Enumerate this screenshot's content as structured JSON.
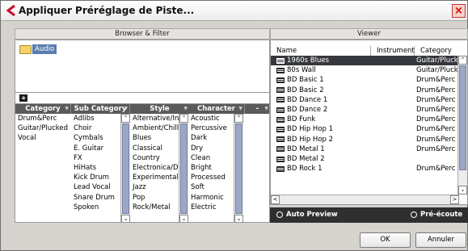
{
  "window": {
    "title": "Appliquer Préréglage de Piste...",
    "close_glyph": "×"
  },
  "browser": {
    "title": "Browser & Filter",
    "folder_label": "Audio",
    "filter_icon_glyph": "a"
  },
  "filter": {
    "columns": [
      {
        "header": "Category",
        "items": [
          "Drum&Perc",
          "Guitar/Plucked",
          "Vocal"
        ]
      },
      {
        "header": "Sub Category",
        "items": [
          "Adlibs",
          "Choir",
          "Cymbals",
          "E. Guitar",
          "FX",
          "HiHats",
          "Kick Drum",
          "Lead Vocal",
          "Snare Drum",
          "Spoken"
        ]
      },
      {
        "header": "Style",
        "items": [
          "Alternative/Inc",
          "Ambient/ChillO",
          "Blues",
          "Classical",
          "Country",
          "Electronica/D",
          "Experimental",
          "Jazz",
          "Pop",
          "Rock/Metal"
        ]
      },
      {
        "header": "Character",
        "items": [
          "Acoustic",
          "Percussive",
          "Dark",
          "Dry",
          "Clean",
          "Bright",
          "Processed",
          "Soft",
          "Harmonic",
          "Electric"
        ]
      }
    ],
    "extra_header": "-"
  },
  "viewer": {
    "title": "Viewer",
    "headers": {
      "name": "Name",
      "instrument": "Instrument",
      "category": "Category"
    },
    "rows": [
      {
        "name": "1960s Blues",
        "category": "Guitar/Pluck",
        "selected": true
      },
      {
        "name": "80s Wall",
        "category": "Guitar/Pluck",
        "selected": false
      },
      {
        "name": "BD Basic 1",
        "category": "Drum&Perc",
        "selected": false
      },
      {
        "name": "BD Basic 2",
        "category": "Drum&Perc",
        "selected": false
      },
      {
        "name": "BD Dance 1",
        "category": "Drum&Perc",
        "selected": false
      },
      {
        "name": "BD Dance 2",
        "category": "Drum&Perc",
        "selected": false
      },
      {
        "name": "BD Funk",
        "category": "Drum&Perc",
        "selected": false
      },
      {
        "name": "BD Hip Hop 1",
        "category": "Drum&Perc",
        "selected": false
      },
      {
        "name": "BD Hip Hop 2",
        "category": "Drum&Perc",
        "selected": false
      },
      {
        "name": "BD Metal 1",
        "category": "Drum&Perc",
        "selected": false
      },
      {
        "name": "BD Metal 2",
        "category": "",
        "selected": false
      },
      {
        "name": "BD Rock 1",
        "category": "Drum&Perc",
        "selected": false
      }
    ]
  },
  "preview": {
    "auto_label": "Auto Preview",
    "pre_label": "Pré-écoute"
  },
  "buttons": {
    "ok": "OK",
    "cancel": "Annuler"
  },
  "scroll_glyphs": {
    "up": "⌃",
    "down": "⌄",
    "left": "<",
    "right": ">"
  },
  "colors": {
    "selection": "#36383d",
    "header": "#5a5a5a",
    "scroll_thumb": "#9ca6c6"
  }
}
